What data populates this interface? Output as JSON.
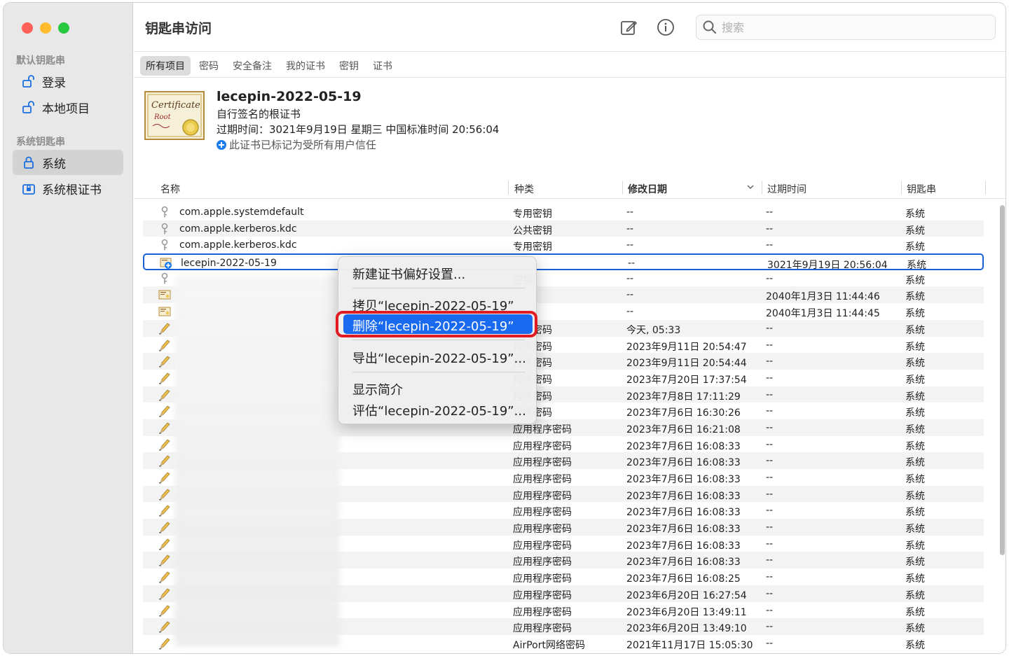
{
  "app": {
    "title": "钥匙串访问",
    "search_placeholder": "搜索"
  },
  "sidebar": {
    "section_default": "默认钥匙串",
    "section_system": "系统钥匙串",
    "items": [
      {
        "label": "登录",
        "icon": "unlocked-padlock-icon"
      },
      {
        "label": "本地项目",
        "icon": "unlocked-padlock-icon"
      },
      {
        "label": "系统",
        "icon": "locked-padlock-icon",
        "selected": true
      },
      {
        "label": "系统根证书",
        "icon": "locked-cabinet-icon"
      }
    ]
  },
  "tabs": [
    "所有项目",
    "密码",
    "安全备注",
    "我的证书",
    "密钥",
    "证书"
  ],
  "detail": {
    "name": "lecepin-2022-05-19",
    "subtitle": "自行签名的根证书",
    "expiry": "过期时间：3021年9月19日 星期三 中国标准时间 20:56:04",
    "trust": "此证书已标记为受所有用户信任",
    "cert_image_text": "Certificate Root"
  },
  "table": {
    "headers": {
      "name": "名称",
      "kind": "种类",
      "modified": "修改日期",
      "expires": "过期时间",
      "keychain": "钥匙串"
    },
    "rows": [
      {
        "icon": "key",
        "name": "com.apple.systemdefault",
        "kind": "专用密钥",
        "modified": "--",
        "expires": "--",
        "keychain": "系统"
      },
      {
        "icon": "key",
        "name": "com.apple.kerberos.kdc",
        "kind": "公共密钥",
        "modified": "--",
        "expires": "--",
        "keychain": "系统"
      },
      {
        "icon": "key",
        "name": "com.apple.kerberos.kdc",
        "kind": "专用密钥",
        "modified": "--",
        "expires": "--",
        "keychain": "系统"
      },
      {
        "icon": "cert-plus",
        "name": "lecepin-2022-05-19",
        "kind": "",
        "modified": "--",
        "expires": "3021年9月19日 20:56:04",
        "keychain": "系统",
        "selected": true
      },
      {
        "icon": "key",
        "name": "",
        "kind": "密钥",
        "modified": "--",
        "expires": "--",
        "keychain": "系统"
      },
      {
        "icon": "cert",
        "name": "",
        "kind": "",
        "modified": "--",
        "expires": "2040年1月3日 11:44:46",
        "keychain": "系统"
      },
      {
        "icon": "cert",
        "name": "",
        "kind": "",
        "modified": "--",
        "expires": "2040年1月3日 11:44:45",
        "keychain": "系统"
      },
      {
        "icon": "pencil",
        "name": "",
        "kind": "程序密码",
        "modified": "今天, 05:33",
        "expires": "--",
        "keychain": "系统"
      },
      {
        "icon": "pencil",
        "name": "",
        "kind": "程序密码",
        "modified": "2023年9月11日 20:54:47",
        "expires": "--",
        "keychain": "系统"
      },
      {
        "icon": "pencil",
        "name": "",
        "kind": "程序密码",
        "modified": "2023年9月11日 20:54:44",
        "expires": "--",
        "keychain": "系统"
      },
      {
        "icon": "pencil",
        "name": "",
        "kind": "程序密码",
        "modified": "2023年7月20日 17:37:54",
        "expires": "--",
        "keychain": "系统"
      },
      {
        "icon": "pencil",
        "name": "",
        "kind": "程序密码",
        "modified": "2023年7月8日 17:11:29",
        "expires": "--",
        "keychain": "系统"
      },
      {
        "icon": "pencil",
        "name": "",
        "kind": "程序密码",
        "modified": "2023年7月6日 16:30:26",
        "expires": "--",
        "keychain": "系统"
      },
      {
        "icon": "pencil",
        "name": "",
        "kind": "应用程序密码",
        "modified": "2023年7月6日 16:21:08",
        "expires": "--",
        "keychain": "系统"
      },
      {
        "icon": "pencil",
        "name": "",
        "kind": "应用程序密码",
        "modified": "2023年7月6日 16:08:33",
        "expires": "--",
        "keychain": "系统"
      },
      {
        "icon": "pencil",
        "name": "",
        "kind": "应用程序密码",
        "modified": "2023年7月6日 16:08:33",
        "expires": "--",
        "keychain": "系统"
      },
      {
        "icon": "pencil",
        "name": "",
        "kind": "应用程序密码",
        "modified": "2023年7月6日 16:08:33",
        "expires": "--",
        "keychain": "系统"
      },
      {
        "icon": "pencil",
        "name": "",
        "kind": "应用程序密码",
        "modified": "2023年7月6日 16:08:33",
        "expires": "--",
        "keychain": "系统"
      },
      {
        "icon": "pencil",
        "name": "",
        "kind": "应用程序密码",
        "modified": "2023年7月6日 16:08:33",
        "expires": "--",
        "keychain": "系统"
      },
      {
        "icon": "pencil",
        "name": "",
        "kind": "应用程序密码",
        "modified": "2023年7月6日 16:08:33",
        "expires": "--",
        "keychain": "系统"
      },
      {
        "icon": "pencil",
        "name": "",
        "kind": "应用程序密码",
        "modified": "2023年7月6日 16:08:33",
        "expires": "--",
        "keychain": "系统"
      },
      {
        "icon": "pencil",
        "name": "",
        "kind": "应用程序密码",
        "modified": "2023年7月6日 16:08:33",
        "expires": "--",
        "keychain": "系统"
      },
      {
        "icon": "pencil",
        "name": "",
        "kind": "应用程序密码",
        "modified": "2023年7月6日 16:08:25",
        "expires": "--",
        "keychain": "系统"
      },
      {
        "icon": "pencil",
        "name": "",
        "kind": "应用程序密码",
        "modified": "2023年6月20日 16:27:54",
        "expires": "--",
        "keychain": "系统"
      },
      {
        "icon": "pencil",
        "name": "",
        "kind": "应用程序密码",
        "modified": "2023年6月20日 13:49:11",
        "expires": "--",
        "keychain": "系统"
      },
      {
        "icon": "pencil",
        "name": "",
        "kind": "应用程序密码",
        "modified": "2023年6月20日 13:49:10",
        "expires": "--",
        "keychain": "系统"
      },
      {
        "icon": "pencil",
        "name": "",
        "kind": "AirPort网络密码",
        "modified": "2021年11月17日 15:05:30",
        "expires": "--",
        "keychain": "系统"
      }
    ]
  },
  "context_menu": {
    "new_pref": "新建证书偏好设置...",
    "copy": "拷贝“lecepin-2022-05-19”",
    "delete": "删除“lecepin-2022-05-19”",
    "export": "导出“lecepin-2022-05-19”...",
    "info": "显示简介",
    "evaluate": "评估“lecepin-2022-05-19”..."
  },
  "colors": {
    "selection_blue": "#1a6af0",
    "highlight_ring": "#e01b24"
  }
}
